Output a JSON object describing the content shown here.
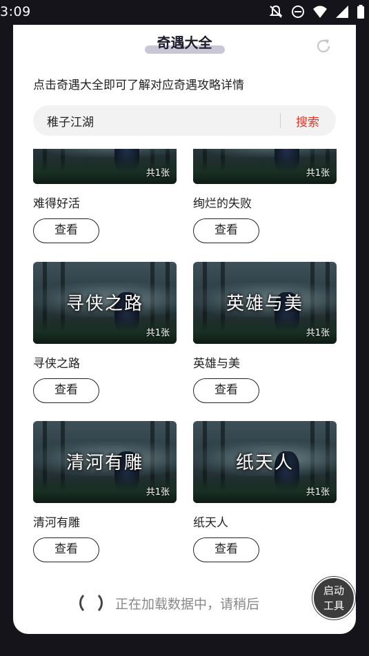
{
  "status_bar": {
    "time": "3:09",
    "icons": [
      "bell-off-icon",
      "do-not-disturb-icon",
      "wifi-icon",
      "cell-signal-icon",
      "battery-icon"
    ]
  },
  "header": {
    "title": "奇遇大全",
    "refresh_icon": "refresh-icon"
  },
  "hint": "点击奇遇大全即可了解对应奇遇攻略详情",
  "search": {
    "value": "稚子江湖",
    "button_label": "搜索"
  },
  "cards": [
    {
      "name": "难得好活",
      "thumb_title": "",
      "count": "共1张",
      "button": "查看"
    },
    {
      "name": "绚烂的失败",
      "thumb_title": "",
      "count": "共1张",
      "button": "查看"
    },
    {
      "name": "寻侠之路",
      "thumb_title": "寻侠之路",
      "count": "共1张",
      "button": "查看"
    },
    {
      "name": "英雄与美",
      "thumb_title": "英雄与美",
      "count": "共1张",
      "button": "查看"
    },
    {
      "name": "清河有雕",
      "thumb_title": "清河有雕",
      "count": "共1张",
      "button": "查看"
    },
    {
      "name": "纸天人",
      "thumb_title": "纸天人",
      "count": "共1张",
      "button": "查看"
    }
  ],
  "loading_text": "正在加载数据中，请稍后",
  "fab": {
    "line1": "启动",
    "line2": "工具"
  },
  "colors": {
    "accent": "#e0392b",
    "background": "#14141a",
    "panel": "#ffffff"
  }
}
